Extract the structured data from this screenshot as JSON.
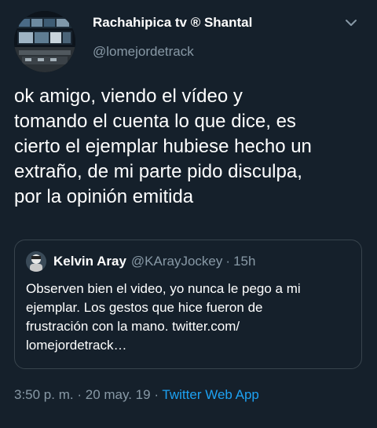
{
  "author": {
    "display_name": "Rachahipica tv ® Shantal",
    "handle": "@lomejordetrack"
  },
  "tweet": {
    "text": "ok amigo, viendo el vídeo y\ntomando el cuenta lo que dice, es\ncierto el ejemplar hubiese hecho un\nextraño, de mi parte pido disculpa,\npor la opinión emitida"
  },
  "quoted_tweet": {
    "display_name": "Kelvin Aray",
    "handle": "@KArayJockey",
    "separator": "·",
    "time": "15h",
    "text": "Observen bien el video, yo nunca le pego a mi\nejemplar. Los gestos que hice fueron de\nfrustración con la mano. twitter.com/\nlomejordetrack…"
  },
  "meta": {
    "time": "3:50 p. m.",
    "sep1": "·",
    "date": "20 may. 19",
    "sep2": "·",
    "app": "Twitter Web App"
  },
  "icons": {
    "menu": "chevron-down-icon"
  },
  "colors": {
    "background": "#15202b",
    "text_primary": "#ffffff",
    "text_secondary": "#8899a6",
    "link": "#1da1f2",
    "border": "#38444d"
  }
}
